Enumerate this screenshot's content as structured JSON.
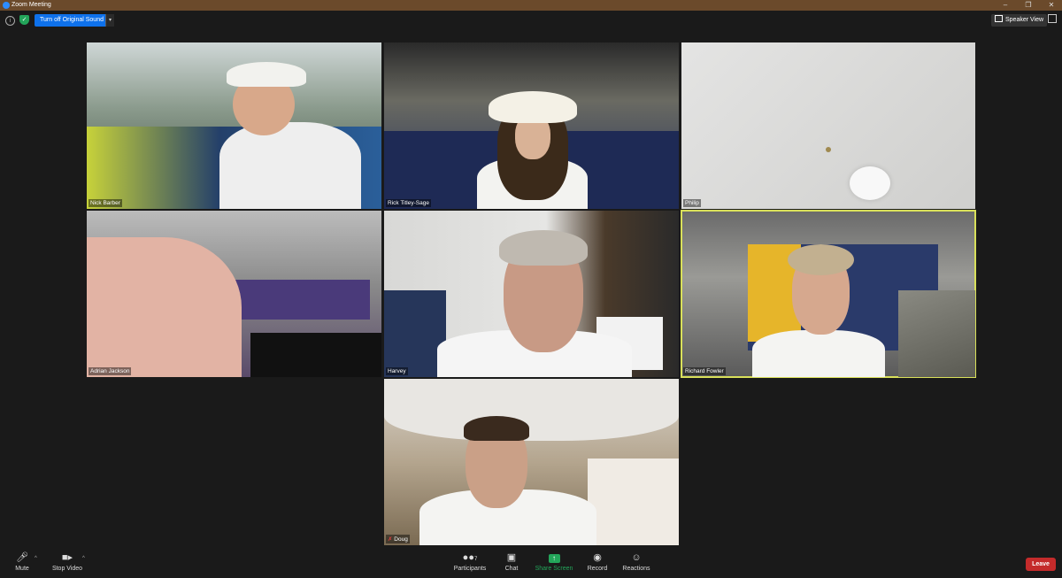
{
  "window": {
    "title": "Zoom Meeting"
  },
  "topbar": {
    "original_sound_label": "Turn off Original Sound",
    "speaker_view_label": "Speaker View"
  },
  "participants": [
    {
      "name": "Nick Barber"
    },
    {
      "name": "Rick Titley-Sage"
    },
    {
      "name": "Philip"
    },
    {
      "name": "Adrian Jackson"
    },
    {
      "name": "Harvey"
    },
    {
      "name": "Richard Fowler"
    },
    {
      "name": "Doug"
    }
  ],
  "controls": {
    "mute": "Mute",
    "stop_video": "Stop Video",
    "participants": "Participants",
    "participants_count": "7",
    "chat": "Chat",
    "share_screen": "Share Screen",
    "record": "Record",
    "reactions": "Reactions",
    "leave": "Leave"
  },
  "colors": {
    "title_bar": "#6b4a2b",
    "background": "#1a1a1a",
    "accent_blue": "#0e71eb",
    "active_speaker": "#d9e05a",
    "leave_red": "#c42b2b",
    "share_green": "#23a55a"
  }
}
